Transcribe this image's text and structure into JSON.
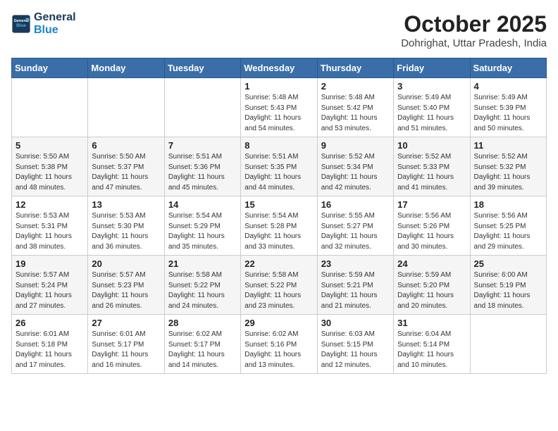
{
  "logo": {
    "line1": "General",
    "line2": "Blue"
  },
  "header": {
    "month": "October 2025",
    "location": "Dohrighat, Uttar Pradesh, India"
  },
  "weekdays": [
    "Sunday",
    "Monday",
    "Tuesday",
    "Wednesday",
    "Thursday",
    "Friday",
    "Saturday"
  ],
  "weeks": [
    [
      {
        "day": "",
        "info": ""
      },
      {
        "day": "",
        "info": ""
      },
      {
        "day": "",
        "info": ""
      },
      {
        "day": "1",
        "info": "Sunrise: 5:48 AM\nSunset: 5:43 PM\nDaylight: 11 hours\nand 54 minutes."
      },
      {
        "day": "2",
        "info": "Sunrise: 5:48 AM\nSunset: 5:42 PM\nDaylight: 11 hours\nand 53 minutes."
      },
      {
        "day": "3",
        "info": "Sunrise: 5:49 AM\nSunset: 5:40 PM\nDaylight: 11 hours\nand 51 minutes."
      },
      {
        "day": "4",
        "info": "Sunrise: 5:49 AM\nSunset: 5:39 PM\nDaylight: 11 hours\nand 50 minutes."
      }
    ],
    [
      {
        "day": "5",
        "info": "Sunrise: 5:50 AM\nSunset: 5:38 PM\nDaylight: 11 hours\nand 48 minutes."
      },
      {
        "day": "6",
        "info": "Sunrise: 5:50 AM\nSunset: 5:37 PM\nDaylight: 11 hours\nand 47 minutes."
      },
      {
        "day": "7",
        "info": "Sunrise: 5:51 AM\nSunset: 5:36 PM\nDaylight: 11 hours\nand 45 minutes."
      },
      {
        "day": "8",
        "info": "Sunrise: 5:51 AM\nSunset: 5:35 PM\nDaylight: 11 hours\nand 44 minutes."
      },
      {
        "day": "9",
        "info": "Sunrise: 5:52 AM\nSunset: 5:34 PM\nDaylight: 11 hours\nand 42 minutes."
      },
      {
        "day": "10",
        "info": "Sunrise: 5:52 AM\nSunset: 5:33 PM\nDaylight: 11 hours\nand 41 minutes."
      },
      {
        "day": "11",
        "info": "Sunrise: 5:52 AM\nSunset: 5:32 PM\nDaylight: 11 hours\nand 39 minutes."
      }
    ],
    [
      {
        "day": "12",
        "info": "Sunrise: 5:53 AM\nSunset: 5:31 PM\nDaylight: 11 hours\nand 38 minutes."
      },
      {
        "day": "13",
        "info": "Sunrise: 5:53 AM\nSunset: 5:30 PM\nDaylight: 11 hours\nand 36 minutes."
      },
      {
        "day": "14",
        "info": "Sunrise: 5:54 AM\nSunset: 5:29 PM\nDaylight: 11 hours\nand 35 minutes."
      },
      {
        "day": "15",
        "info": "Sunrise: 5:54 AM\nSunset: 5:28 PM\nDaylight: 11 hours\nand 33 minutes."
      },
      {
        "day": "16",
        "info": "Sunrise: 5:55 AM\nSunset: 5:27 PM\nDaylight: 11 hours\nand 32 minutes."
      },
      {
        "day": "17",
        "info": "Sunrise: 5:56 AM\nSunset: 5:26 PM\nDaylight: 11 hours\nand 30 minutes."
      },
      {
        "day": "18",
        "info": "Sunrise: 5:56 AM\nSunset: 5:25 PM\nDaylight: 11 hours\nand 29 minutes."
      }
    ],
    [
      {
        "day": "19",
        "info": "Sunrise: 5:57 AM\nSunset: 5:24 PM\nDaylight: 11 hours\nand 27 minutes."
      },
      {
        "day": "20",
        "info": "Sunrise: 5:57 AM\nSunset: 5:23 PM\nDaylight: 11 hours\nand 26 minutes."
      },
      {
        "day": "21",
        "info": "Sunrise: 5:58 AM\nSunset: 5:22 PM\nDaylight: 11 hours\nand 24 minutes."
      },
      {
        "day": "22",
        "info": "Sunrise: 5:58 AM\nSunset: 5:22 PM\nDaylight: 11 hours\nand 23 minutes."
      },
      {
        "day": "23",
        "info": "Sunrise: 5:59 AM\nSunset: 5:21 PM\nDaylight: 11 hours\nand 21 minutes."
      },
      {
        "day": "24",
        "info": "Sunrise: 5:59 AM\nSunset: 5:20 PM\nDaylight: 11 hours\nand 20 minutes."
      },
      {
        "day": "25",
        "info": "Sunrise: 6:00 AM\nSunset: 5:19 PM\nDaylight: 11 hours\nand 18 minutes."
      }
    ],
    [
      {
        "day": "26",
        "info": "Sunrise: 6:01 AM\nSunset: 5:18 PM\nDaylight: 11 hours\nand 17 minutes."
      },
      {
        "day": "27",
        "info": "Sunrise: 6:01 AM\nSunset: 5:17 PM\nDaylight: 11 hours\nand 16 minutes."
      },
      {
        "day": "28",
        "info": "Sunrise: 6:02 AM\nSunset: 5:17 PM\nDaylight: 11 hours\nand 14 minutes."
      },
      {
        "day": "29",
        "info": "Sunrise: 6:02 AM\nSunset: 5:16 PM\nDaylight: 11 hours\nand 13 minutes."
      },
      {
        "day": "30",
        "info": "Sunrise: 6:03 AM\nSunset: 5:15 PM\nDaylight: 11 hours\nand 12 minutes."
      },
      {
        "day": "31",
        "info": "Sunrise: 6:04 AM\nSunset: 5:14 PM\nDaylight: 11 hours\nand 10 minutes."
      },
      {
        "day": "",
        "info": ""
      }
    ]
  ]
}
